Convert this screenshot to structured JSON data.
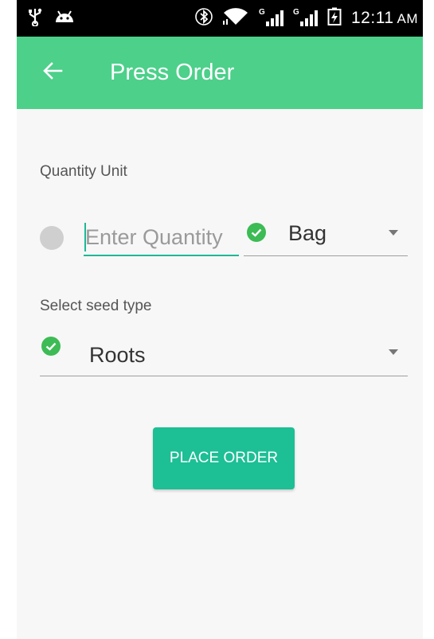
{
  "status_bar": {
    "time": "12:11",
    "ampm": "AM",
    "network_label": "G",
    "icons": [
      "usb-icon",
      "android-icon",
      "bluetooth-icon",
      "wifi-icon",
      "signal-icon",
      "signal-icon",
      "battery-icon"
    ]
  },
  "app_bar": {
    "title": "Press Order",
    "back_icon": "arrow-back-icon",
    "color": "#4cd08a"
  },
  "form": {
    "quantity_unit_label": "Quantity Unit",
    "quantity_input": {
      "value": "",
      "placeholder": "Enter Quantity"
    },
    "unit_spinner": {
      "selected": "Bag"
    },
    "seed_type_label": "Select seed type",
    "seed_spinner": {
      "selected": "Roots"
    },
    "place_order_label": "PLACE ORDER"
  },
  "colors": {
    "accent": "#1dbf95",
    "check": "#3dbb55",
    "background": "#f7f7f7"
  }
}
